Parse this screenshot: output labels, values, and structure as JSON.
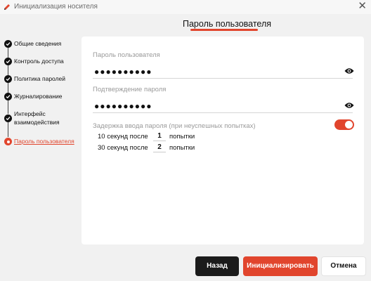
{
  "window": {
    "title": "Инициализация носителя",
    "close_glyph": "✕"
  },
  "page": {
    "title": "Пароль пользователя"
  },
  "steps": [
    {
      "label": "Общие сведения",
      "state": "done"
    },
    {
      "label": "Контроль доступа",
      "state": "done"
    },
    {
      "label": "Политика паролей",
      "state": "done"
    },
    {
      "label": "Журналирование",
      "state": "done"
    },
    {
      "label_lines": [
        "Интерфейс",
        "взаимодействия"
      ],
      "state": "done"
    },
    {
      "label": "Пароль пользователя",
      "state": "current"
    }
  ],
  "form": {
    "password": {
      "label": "Пароль пользователя",
      "value": "●●●●●●●●●●",
      "icon": "eye-icon"
    },
    "confirm": {
      "label": "Подтверждение пароля",
      "value": "●●●●●●●●●●",
      "icon": "eye-icon"
    },
    "delay": {
      "label": "Задержка ввода пароля (при неуспешных попытках)",
      "enabled": true,
      "rows": [
        {
          "prefix": "10 секунд после",
          "value": "1",
          "suffix": "попытки"
        },
        {
          "prefix": "30 секунд после",
          "value": "2",
          "suffix": "попытки"
        }
      ]
    }
  },
  "buttons": {
    "back": "Назад",
    "init": "Инициализировать",
    "cancel": "Отмена"
  },
  "colors": {
    "accent": "#e1452d",
    "dark": "#1b1b1b",
    "background": "#f1f1f1"
  }
}
